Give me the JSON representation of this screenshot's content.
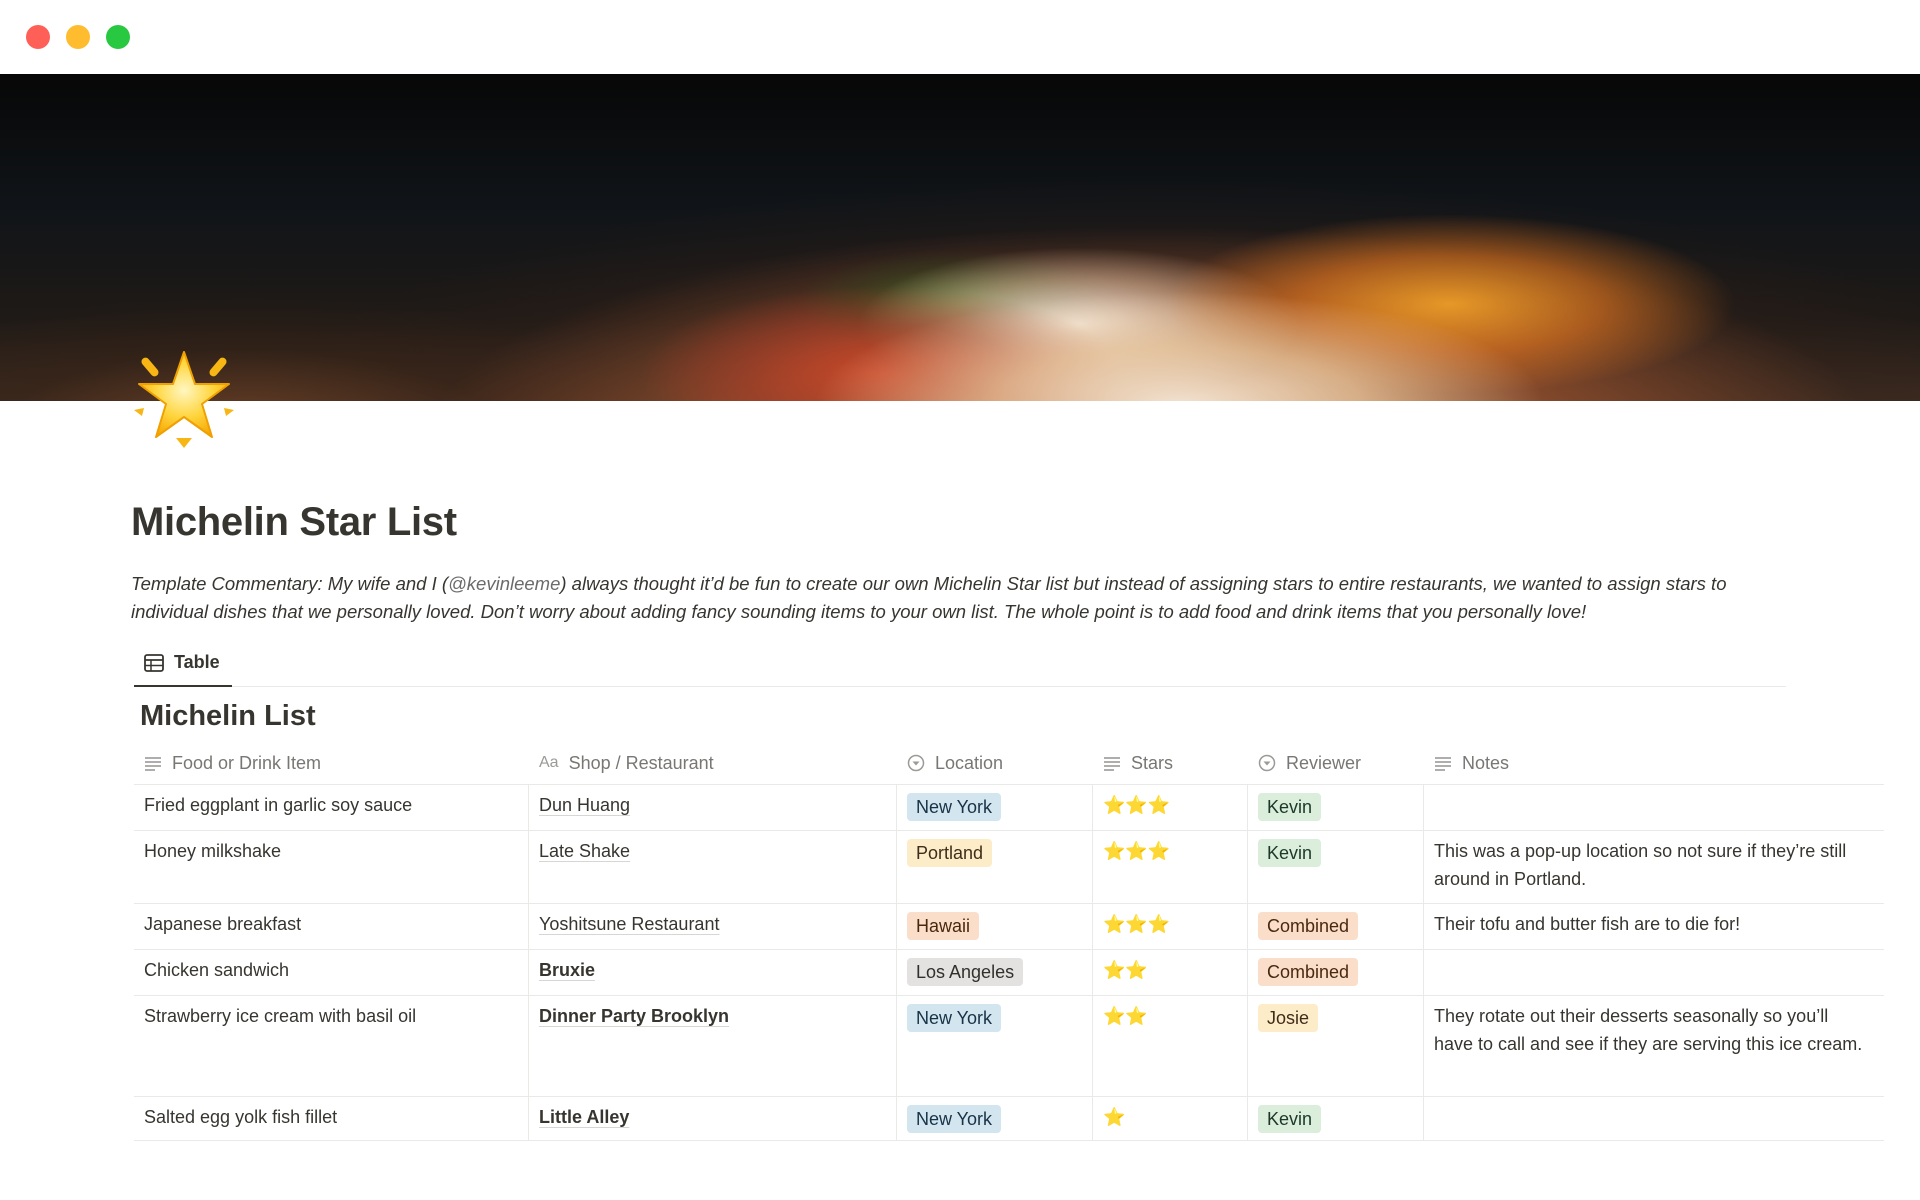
{
  "page": {
    "title": "Michelin Star List",
    "commentary_prefix": "Template Commentary: My wife and I (",
    "commentary_mention": "@kevinleeme",
    "commentary_suffix": ") always thought it’d be fun to create our own Michelin Star list but instead of assigning stars to entire restaurants, we wanted to assign stars to individual dishes that we personally loved. Don’t worry about adding fancy sounding items to your own list. The whole point is to add food and drink items that you personally love!",
    "icon": "glowing-star-icon"
  },
  "views": [
    {
      "label": "Table",
      "icon": "table-icon",
      "active": true
    }
  ],
  "database": {
    "title": "Michelin List",
    "columns": [
      {
        "label": "Food or Drink Item",
        "icon": "text-lines-icon"
      },
      {
        "label": "Shop / Restaurant",
        "icon": "title-aa-icon",
        "icon_text": "Aa"
      },
      {
        "label": "Location",
        "icon": "select-icon"
      },
      {
        "label": "Stars",
        "icon": "text-lines-icon"
      },
      {
        "label": "Reviewer",
        "icon": "select-icon"
      },
      {
        "label": "Notes",
        "icon": "text-lines-icon"
      }
    ],
    "rows": [
      {
        "item": "Fried eggplant in garlic soy sauce",
        "shop": "Dun Huang",
        "location": "New York",
        "stars": "⭐⭐⭐",
        "reviewer": "Kevin",
        "notes": ""
      },
      {
        "item": "Honey milkshake",
        "shop": "Late Shake",
        "location": "Portland",
        "stars": "⭐⭐⭐",
        "reviewer": "Kevin",
        "notes": "This was a pop-up location so not sure if they’re still around in Portland."
      },
      {
        "item": "Japanese breakfast",
        "shop": "Yoshitsune Restaurant",
        "location": "Hawaii",
        "stars": "⭐⭐⭐",
        "reviewer": "Combined",
        "notes": "Their tofu and butter fish are to die for!"
      },
      {
        "item": "Chicken sandwich",
        "shop": "Bruxie",
        "location": "Los Angeles",
        "stars": "⭐⭐",
        "reviewer": "Combined",
        "notes": ""
      },
      {
        "item": "Strawberry ice cream with basil oil",
        "shop": "Dinner Party Brooklyn",
        "location": "New York",
        "stars": "⭐⭐",
        "reviewer": "Josie",
        "notes": "They rotate out their desserts seasonally so you’ll have to call and see if they are serving this ice cream."
      },
      {
        "item": "Salted egg yolk fish fillet",
        "shop": "Little Alley",
        "location": "New York",
        "stars": "⭐",
        "reviewer": "Kevin",
        "notes": ""
      }
    ]
  },
  "tag_colors": {
    "New York": {
      "bg": "#d3e5ef",
      "fg": "#183347"
    },
    "Portland": {
      "bg": "#fdecc8",
      "fg": "#402c1b"
    },
    "Hawaii": {
      "bg": "#fadec9",
      "fg": "#49290e"
    },
    "Los Angeles": {
      "bg": "#e3e2e0",
      "fg": "#32302c"
    },
    "Kevin": {
      "bg": "#dbeddb",
      "fg": "#1c3829"
    },
    "Combined": {
      "bg": "#fadec9",
      "fg": "#49290e"
    },
    "Josie": {
      "bg": "#fdecc8",
      "fg": "#402c1b"
    }
  }
}
